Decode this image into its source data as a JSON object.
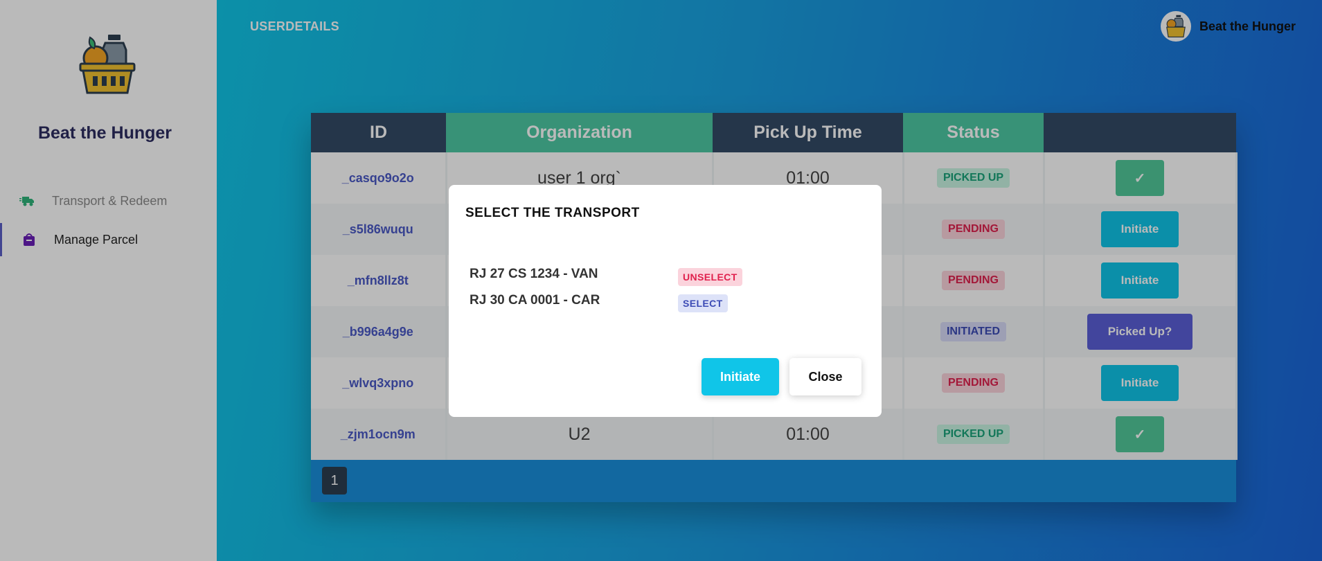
{
  "app": {
    "brand": "Beat the Hunger",
    "page_title": "USERDETAILS",
    "user_name": "Beat the Hunger"
  },
  "sidebar": {
    "items": [
      {
        "label": "Transport & Redeem",
        "icon": "truck-icon",
        "active": false
      },
      {
        "label": "Manage Parcel",
        "icon": "parcel-icon",
        "active": true
      }
    ]
  },
  "table": {
    "headers": [
      "ID",
      "Organization",
      "Pick Up Time",
      "Status",
      ""
    ],
    "rows": [
      {
        "id": "_casqo9o2o",
        "org": "user 1 org`",
        "time": "01:00",
        "status": "PICKED UP",
        "action": "✓"
      },
      {
        "id": "_s5l86wuqu",
        "org": "",
        "time": "",
        "status": "PENDING",
        "action": "Initiate"
      },
      {
        "id": "_mfn8llz8t",
        "org": "",
        "time": "",
        "status": "PENDING",
        "action": "Initiate"
      },
      {
        "id": "_b996a4g9e",
        "org": "",
        "time": "",
        "status": "INITIATED",
        "action": "Picked Up?"
      },
      {
        "id": "_wlvq3xpno",
        "org": "",
        "time": "",
        "status": "PENDING",
        "action": "Initiate"
      },
      {
        "id": "_zjm1ocn9m",
        "org": "U2",
        "time": "01:00",
        "status": "PICKED UP",
        "action": "✓"
      }
    ],
    "page": "1"
  },
  "modal": {
    "title": "SELECT THE TRANSPORT",
    "transports": [
      {
        "name": "RJ 27 CS 1234 - VAN",
        "tag": "UNSELECT"
      },
      {
        "name": "RJ 30 CA 0001 - CAR",
        "tag": "SELECT"
      }
    ],
    "initiate_label": "Initiate",
    "close_label": "Close"
  },
  "colors": {
    "header_dark": "#344a66",
    "header_green": "#4ec8a3",
    "accent_cyan": "#10c5e8",
    "accent_indigo": "#5b5fd8"
  }
}
